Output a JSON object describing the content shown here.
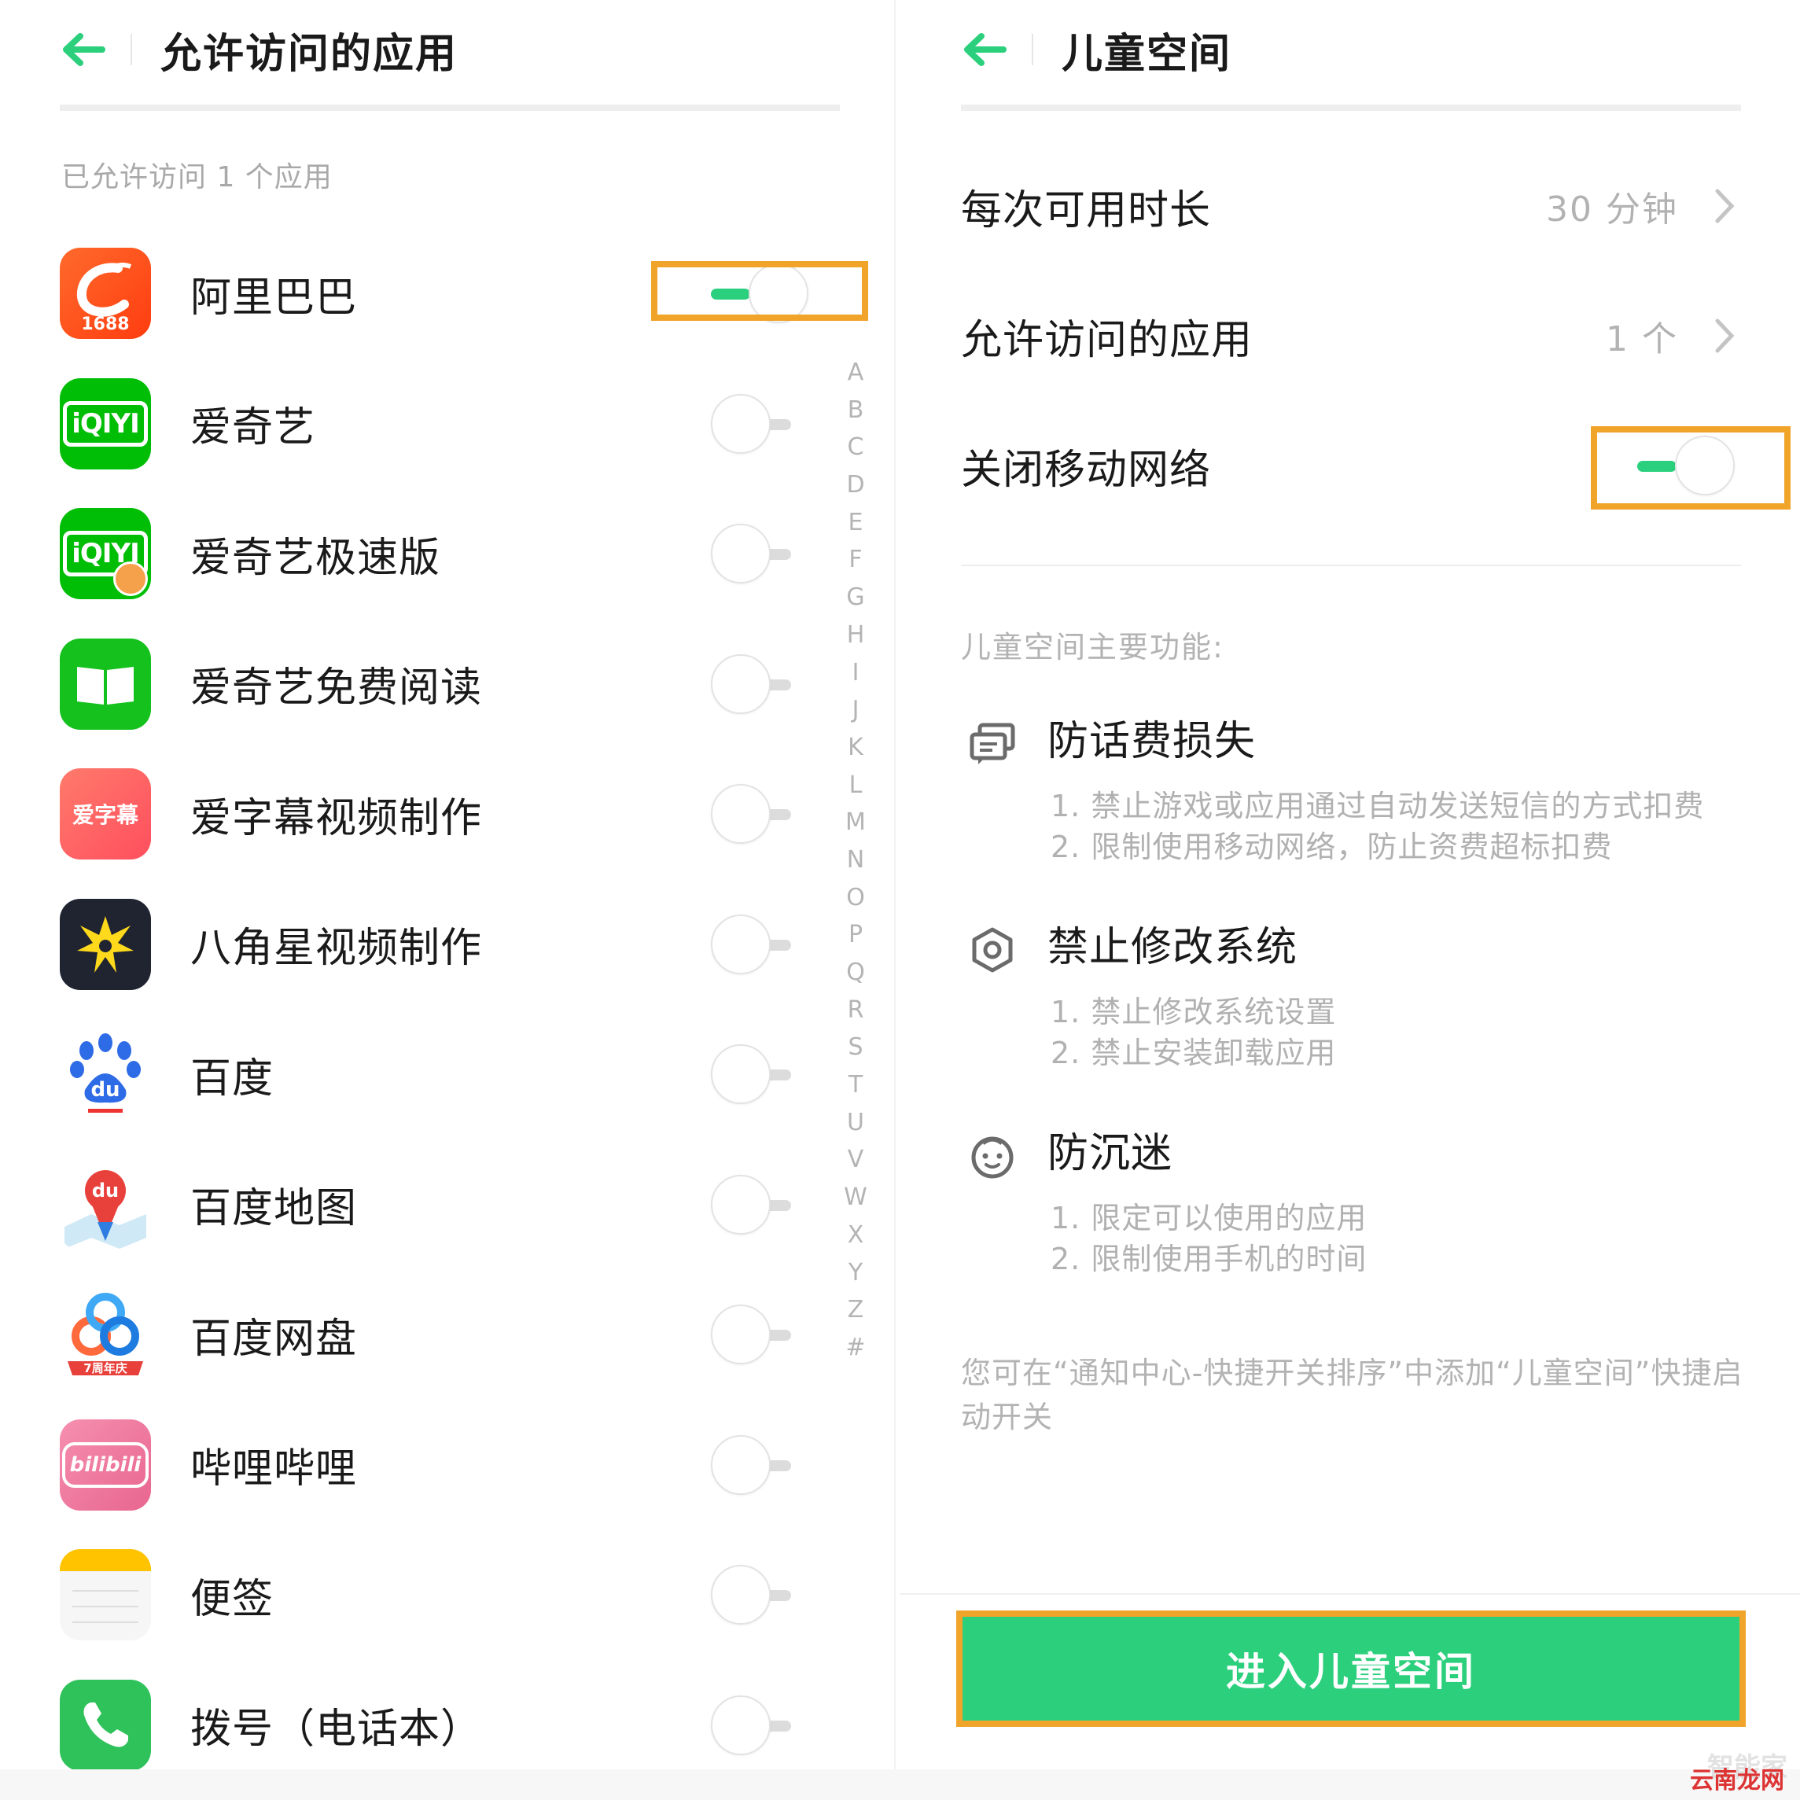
{
  "left": {
    "title": "允许访问的应用",
    "subtitle": "已允许访问 1 个应用",
    "apps": [
      {
        "name": "阿里巴巴",
        "icon": "alibaba-1688-icon",
        "icon_text": "1688",
        "enabled": true
      },
      {
        "name": "爱奇艺",
        "icon": "iqiyi-icon",
        "icon_text": "iQIYI",
        "enabled": false
      },
      {
        "name": "爱奇艺极速版",
        "icon": "iqiyi-lite-icon",
        "icon_text": "iQIYI",
        "enabled": false
      },
      {
        "name": "爱奇艺免费阅读",
        "icon": "iqiyi-reader-icon",
        "icon_text": "",
        "enabled": false
      },
      {
        "name": "爱字幕视频制作",
        "icon": "aizimu-icon",
        "icon_text": "爱字幕",
        "enabled": false
      },
      {
        "name": "八角星视频制作",
        "icon": "bajiaoxing-icon",
        "icon_text": "",
        "enabled": false
      },
      {
        "name": "百度",
        "icon": "baidu-icon",
        "icon_text": "du",
        "enabled": false
      },
      {
        "name": "百度地图",
        "icon": "baidu-map-icon",
        "icon_text": "du",
        "enabled": false
      },
      {
        "name": "百度网盘",
        "icon": "baidu-netdisk-icon",
        "icon_text": "7周年庆",
        "enabled": false
      },
      {
        "name": "哔哩哔哩",
        "icon": "bilibili-icon",
        "icon_text": "bilibili",
        "enabled": false
      },
      {
        "name": "便签",
        "icon": "notes-icon",
        "icon_text": "",
        "enabled": false
      },
      {
        "name": "拨号（电话本）",
        "icon": "phone-icon",
        "icon_text": "",
        "enabled": false
      }
    ],
    "index_letters": [
      "A",
      "B",
      "C",
      "D",
      "E",
      "F",
      "G",
      "H",
      "I",
      "J",
      "K",
      "L",
      "M",
      "N",
      "O",
      "P",
      "Q",
      "R",
      "S",
      "T",
      "U",
      "V",
      "W",
      "X",
      "Y",
      "Z",
      "#"
    ]
  },
  "right": {
    "title": "儿童空间",
    "settings": [
      {
        "label": "每次可用时长",
        "value": "30 分钟"
      },
      {
        "label": "允许访问的应用",
        "value": "1 个"
      }
    ],
    "network_toggle": {
      "label": "关闭移动网络",
      "enabled": true
    },
    "features_heading": "儿童空间主要功能:",
    "features": [
      {
        "icon": "message-card-icon",
        "title": "防话费损失",
        "lines": [
          "1. 禁止游戏或应用通过自动发送短信的方式扣费",
          "2. 限制使用移动网络，防止资费超标扣费"
        ]
      },
      {
        "icon": "settings-gear-icon",
        "title": "禁止修改系统",
        "lines": [
          "1. 禁止修改系统设置",
          "2. 禁止安装卸载应用"
        ]
      },
      {
        "icon": "child-face-icon",
        "title": "防沉迷",
        "lines": [
          "1. 限定可以使用的应用",
          "2. 限制使用手机的时间"
        ]
      }
    ],
    "note": "您可在“通知中心-快捷开关排序”中添加“儿童空间”快捷启动开关",
    "enter_button": "进入儿童空间"
  },
  "colors": {
    "accent": "#2bcf7c",
    "highlight": "#f0a42a",
    "muted_text": "#b3b3b3"
  },
  "watermark": "智能家",
  "watermark2": "云南龙网"
}
